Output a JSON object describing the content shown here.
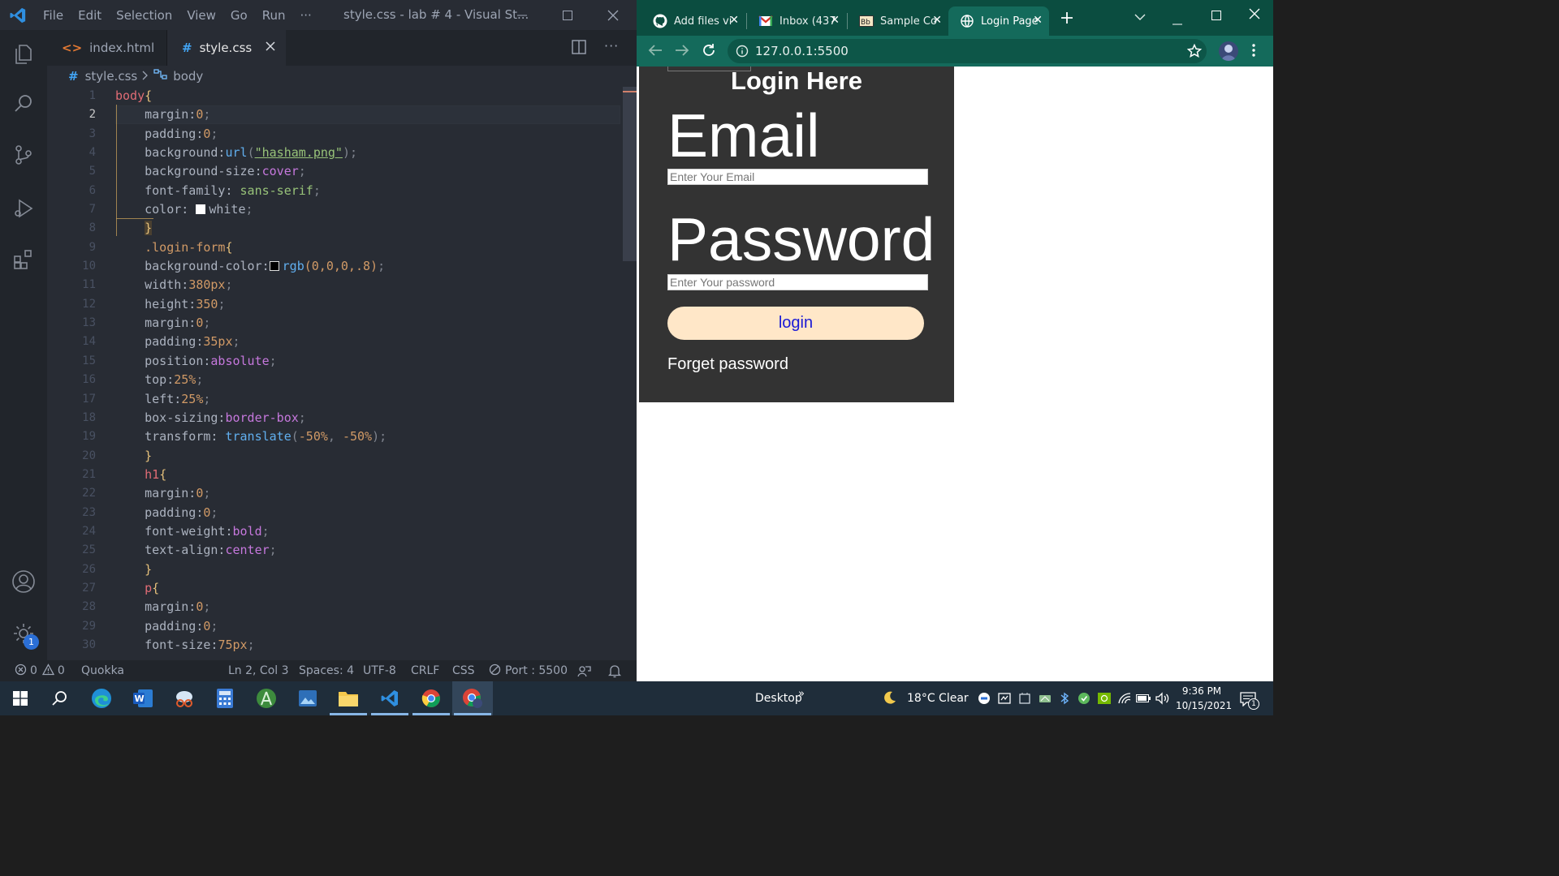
{
  "vscode": {
    "menu": [
      "File",
      "Edit",
      "Selection",
      "View",
      "Go",
      "Run",
      "···"
    ],
    "title": "style.css - lab # 4 - Visual St...",
    "tabs": [
      {
        "label": "index.html",
        "glyph": "<>"
      },
      {
        "label": "style.css",
        "glyph": "#"
      }
    ],
    "breadcrumb": {
      "file": "style.css",
      "symbol": "body"
    },
    "settings_badge": "1",
    "line_numbers": [
      "1",
      "2",
      "3",
      "4",
      "5",
      "6",
      "7",
      "8",
      "9",
      "10",
      "11",
      "12",
      "13",
      "14",
      "15",
      "16",
      "17",
      "18",
      "19",
      "20",
      "21",
      "22",
      "23",
      "24",
      "25",
      "26",
      "27",
      "28",
      "29",
      "30"
    ],
    "code": {
      "l1_sel": "body",
      "l1_brace": "{",
      "l2_prop": "margin:",
      "l2_val": "0",
      "semi": ";",
      "l3_prop": "padding:",
      "l3_val": "0",
      "l4_prop": "background:",
      "l4_fn": "url",
      "l4_open": "(",
      "l4_str": "\"hasham.png\"",
      "l4_close": ")",
      "l5_prop": "background-size:",
      "l5_val": "cover",
      "l6_prop": "font-family: ",
      "l6_val": "sans-serif",
      "l7_prop": "color: ",
      "l7_val": "white",
      "l8_brace": "}",
      "l9_sel": ".login-form",
      "l9_brace": "{",
      "l10_prop": "background-color:",
      "l10_fn": "rgb",
      "l10_args": "(0,0,0,.8)",
      "l11_prop": "width:",
      "l11_val": "380px",
      "l12_prop": "height:",
      "l12_val": "350",
      "l13_prop": "margin:",
      "l13_val": "0",
      "l14_prop": "padding:",
      "l14_val": "35px",
      "l15_prop": "position:",
      "l15_val": "absolute",
      "l16_prop": "top:",
      "l16_val": "25%",
      "l17_prop": "left:",
      "l17_val": "25%",
      "l18_prop": "box-sizing:",
      "l18_val": "border-box",
      "l19_prop": "transform: ",
      "l19_fn": "translate",
      "l19_open": "(",
      "l19_a": "-50%",
      "l19_comma": ", ",
      "l19_b": "-50%",
      "l19_close": ")",
      "l20_brace": "}",
      "l21_sel": "h1",
      "l21_brace": "{",
      "l22_prop": "margin:",
      "l22_val": "0",
      "l23_prop": "padding:",
      "l23_val": "0",
      "l24_prop": "font-weight:",
      "l24_val": "bold",
      "l25_prop": "text-align:",
      "l25_val": "center",
      "l26_brace": "}",
      "l27_sel": "p",
      "l27_brace": "{",
      "l28_prop": "margin:",
      "l28_val": "0",
      "l29_prop": "padding:",
      "l29_val": "0",
      "l30_prop": "font-size:",
      "l30_val": "75px"
    },
    "status": {
      "errors": "0",
      "warnings": "0",
      "quokka": "Quokka",
      "position": "Ln 2, Col 3",
      "spaces": "Spaces: 4",
      "encoding": "UTF-8",
      "eol": "CRLF",
      "language": "CSS",
      "port": "Port : 5500"
    }
  },
  "chrome": {
    "tabs": [
      {
        "label": "Add files vi",
        "favicon": "github-icon"
      },
      {
        "label": "Inbox (437",
        "favicon": "gmail-icon"
      },
      {
        "label": "Sample Co",
        "favicon": "bb-icon"
      },
      {
        "label": "Login Page",
        "favicon": "globe-icon"
      }
    ],
    "url": "127.0.0.1:5500",
    "page": {
      "title": "Login Here",
      "email_label": "Email",
      "email_placeholder": "Enter Your Email",
      "password_label": "Password",
      "password_placeholder": "Enter Your password",
      "login_button": "login",
      "forget_link": "Forget password"
    }
  },
  "taskbar": {
    "desktop_label": "Desktop",
    "desktop_chevron": "»",
    "weather": "18°C  Clear",
    "time": "9:36 PM",
    "date": "10/15/2021",
    "notification_count": "1"
  },
  "colors": {
    "vscode_bg": "#282c34",
    "chrome_frame": "#0b4d40",
    "chrome_toolbar": "#146a5b",
    "login_form_bg": "#333333",
    "login_button_bg": "#ffe7c8",
    "login_button_text": "#1a1ad6",
    "taskbar": "#1f2d3a"
  }
}
